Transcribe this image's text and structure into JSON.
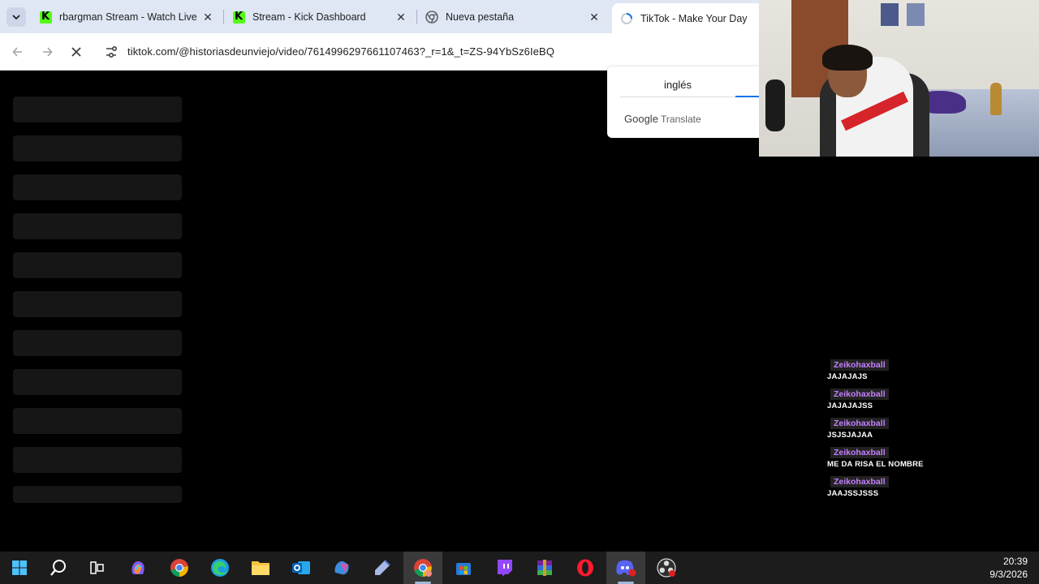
{
  "browser": {
    "tabs": [
      {
        "title": "rbargman Stream - Watch Live",
        "favicon": "kick-icon",
        "active": false
      },
      {
        "title": "Stream - Kick Dashboard",
        "favicon": "kick-icon",
        "active": false
      },
      {
        "title": "Nueva pestaña",
        "favicon": "chrome-icon",
        "active": false
      },
      {
        "title": "TikTok - Make Your Day",
        "favicon": "loading-icon",
        "active": true
      }
    ],
    "tab_close_symbol": "✕",
    "url": "tiktok.com/@historiasdeunviejo/video/7614996297661107463?_r=1&_t=ZS-94YbSz6IeBQ"
  },
  "translate_popup": {
    "language": "inglés",
    "brand_google": "Google",
    "brand_translate": "Translate"
  },
  "chat": {
    "messages": [
      {
        "user": "Zeikohaxball",
        "text": "JAJAJAJS"
      },
      {
        "user": "Zeikohaxball",
        "text": "JAJAJAJSS"
      },
      {
        "user": "Zeikohaxball",
        "text": "JSJSJAJAA"
      },
      {
        "user": "Zeikohaxball",
        "text": "ME DA RISA EL NOMBRE"
      },
      {
        "user": "Zeikohaxball",
        "text": "JAAJSSJSSS"
      }
    ]
  },
  "taskbar": {
    "apps": [
      "start-icon",
      "search-icon",
      "task-view-icon",
      "copilot-icon",
      "chrome-icon",
      "edge-icon",
      "file-explorer-icon",
      "outlook-icon",
      "m365-icon",
      "pen-icon",
      "chrome-profile-icon",
      "store-icon",
      "twitch-icon",
      "winrar-icon",
      "opera-icon",
      "discord-icon",
      "obs-icon"
    ],
    "time": "20:39",
    "date": "9/3/2026"
  },
  "colors": {
    "tabstrip": "#dfe6f4",
    "kick_green": "#53fc18",
    "chat_username": "#c580ff",
    "page_bg": "#000000"
  }
}
